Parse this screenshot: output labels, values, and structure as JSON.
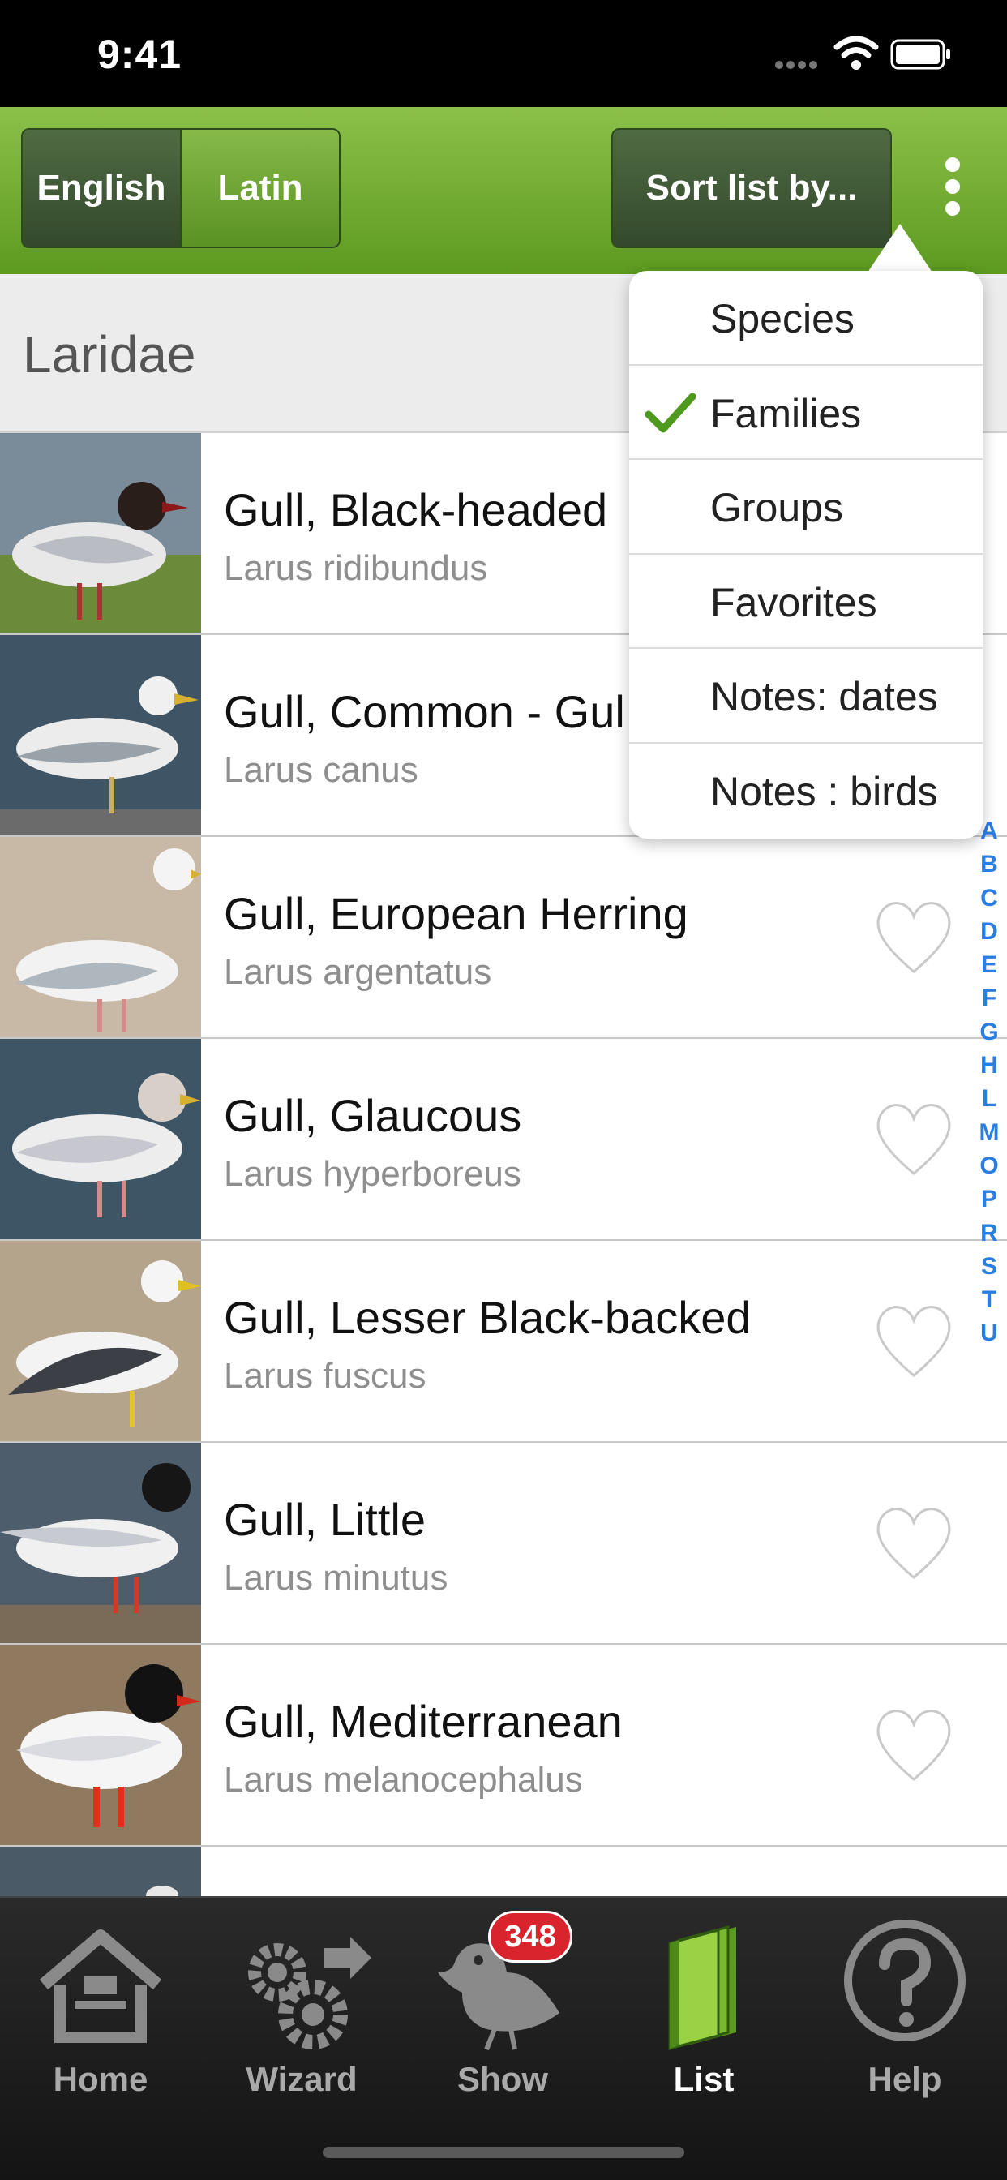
{
  "status_bar": {
    "time": "9:41"
  },
  "header": {
    "language_toggle": {
      "english": "English",
      "latin": "Latin",
      "selected": "Latin"
    },
    "sort_button": "Sort list by...",
    "more_icon": "vertical-ellipsis-icon"
  },
  "section": {
    "title": "Laridae"
  },
  "birds": [
    {
      "name": "Gull, Black-headed",
      "latin": "Larus ridibundus",
      "favorite": false
    },
    {
      "name": "Gull, Common - Gul",
      "latin": "Larus canus",
      "favorite": false
    },
    {
      "name": "Gull, European Herring",
      "latin": "Larus argentatus",
      "favorite": false
    },
    {
      "name": "Gull, Glaucous",
      "latin": "Larus hyperboreus",
      "favorite": false
    },
    {
      "name": "Gull, Lesser Black-backed",
      "latin": "Larus fuscus",
      "favorite": false
    },
    {
      "name": "Gull, Little",
      "latin": "Larus minutus",
      "favorite": false
    },
    {
      "name": "Gull, Mediterranean",
      "latin": "Larus melanocephalus",
      "favorite": false
    }
  ],
  "alphabet_index": [
    "A",
    "B",
    "C",
    "D",
    "E",
    "F",
    "G",
    "H",
    "L",
    "M",
    "O",
    "P",
    "R",
    "S",
    "T",
    "U"
  ],
  "sort_menu": {
    "items": [
      {
        "label": "Species",
        "checked": false
      },
      {
        "label": "Families",
        "checked": true
      },
      {
        "label": "Groups",
        "checked": false
      },
      {
        "label": "Favorites",
        "checked": false
      },
      {
        "label": "Notes: dates",
        "checked": false
      },
      {
        "label": "Notes : birds",
        "checked": false
      }
    ]
  },
  "tab_bar": {
    "tabs": [
      {
        "label": "Home",
        "icon": "house-icon",
        "active": false
      },
      {
        "label": "Wizard",
        "icon": "gears-icon",
        "active": false
      },
      {
        "label": "Show",
        "icon": "bird-icon",
        "active": false,
        "badge": "348"
      },
      {
        "label": "List",
        "icon": "book-icon",
        "active": true
      },
      {
        "label": "Help",
        "icon": "question-icon",
        "active": false
      }
    ]
  },
  "colors": {
    "header_green": "#6faa2f",
    "accent_blue": "#2a7de1",
    "badge_red": "#d9232d",
    "check_green": "#4f9a1e"
  }
}
